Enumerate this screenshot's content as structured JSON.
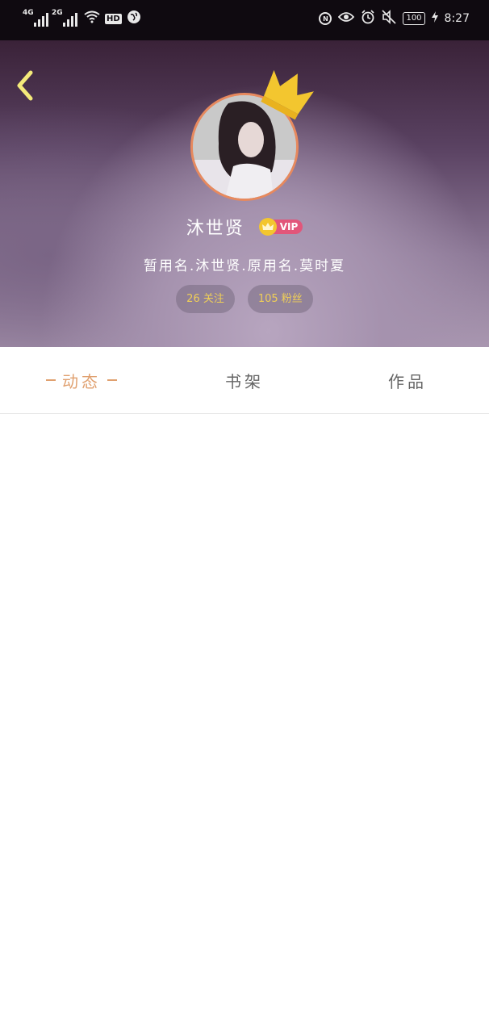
{
  "status_bar": {
    "signal1_tag": "4G",
    "signal2_tag": "2G",
    "hd_label": "HD",
    "nfc_label": "N",
    "battery": "100",
    "time": "8:27"
  },
  "header": {
    "username": "沐世贤",
    "vip_label": "VIP",
    "bio": "暂用名.沐世贤.原用名.莫时夏",
    "stats": {
      "following": "26 关注",
      "fans": "105 粉丝"
    }
  },
  "tabs": [
    {
      "label": "动态",
      "active": true
    },
    {
      "label": "书架",
      "active": false
    },
    {
      "label": "作品",
      "active": false
    }
  ],
  "colors": {
    "accent": "#e0a06f",
    "vip_pink": "#e2567a",
    "crown_gold": "#f3c62f",
    "pill_text": "#f0cf57"
  }
}
